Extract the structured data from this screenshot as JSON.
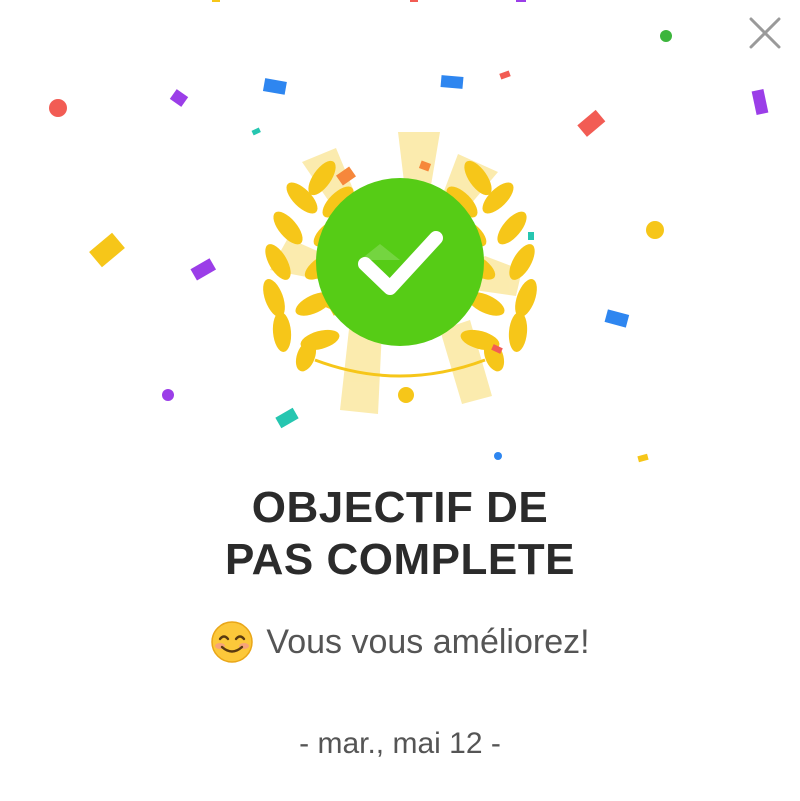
{
  "dialog": {
    "title_line1": "OBJECTIF DE",
    "title_line2": "PAS COMPLETE",
    "message": "Vous vous améliorez!",
    "date": "- mar., mai 12 -"
  },
  "icons": {
    "close": "close-icon",
    "emoji": "smiling-face-emoji",
    "badge": "laurel-checkmark-badge-icon",
    "check": "checkmark-icon"
  },
  "colors": {
    "accent_green": "#56cc16",
    "laurel_gold": "#f6c619",
    "rays": "#fbe9a6",
    "title_text": "#2b2b2b",
    "body_text": "#555555",
    "close_icon": "#9a9a9a"
  }
}
